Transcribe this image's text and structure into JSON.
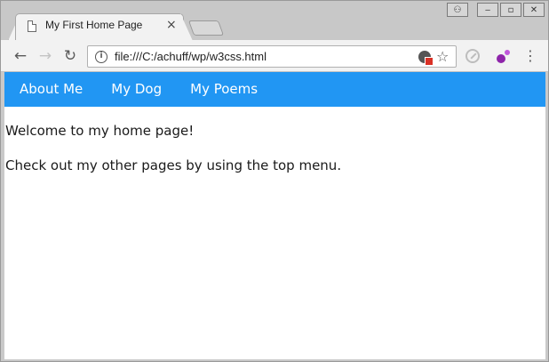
{
  "browser": {
    "tab": {
      "title": "My First Home Page",
      "close_glyph": "×",
      "favicon": "document-icon"
    },
    "window_controls": {
      "user_glyph": "⚇",
      "minimize_glyph": "‒",
      "restore_glyph": "▫",
      "close_glyph": "✕"
    },
    "toolbar": {
      "back_glyph": "←",
      "forward_glyph": "→",
      "reload_glyph": "↻",
      "info_glyph": "i",
      "url": "file:///C:/achuff/wp/w3css.html",
      "star_glyph": "☆",
      "menu_glyph": "⋮"
    },
    "icons": [
      "document-icon",
      "close-icon",
      "user-icon",
      "minimize-icon",
      "restore-icon",
      "back-icon",
      "forward-icon",
      "reload-icon",
      "info-icon",
      "blocked-content-icon",
      "bookmark-star-icon",
      "extension-blocked-icon",
      "extension-dots-icon",
      "menu-icon"
    ]
  },
  "page": {
    "nav": [
      {
        "label": "About Me"
      },
      {
        "label": "My Dog"
      },
      {
        "label": "My Poems"
      }
    ],
    "paragraphs": [
      "Welcome to my home page!",
      "Check out my other pages by using the top menu."
    ]
  },
  "colors": {
    "nav_bar": "#2196f3",
    "nav_text": "#ffffff",
    "extension_purple": "#8e24aa"
  }
}
